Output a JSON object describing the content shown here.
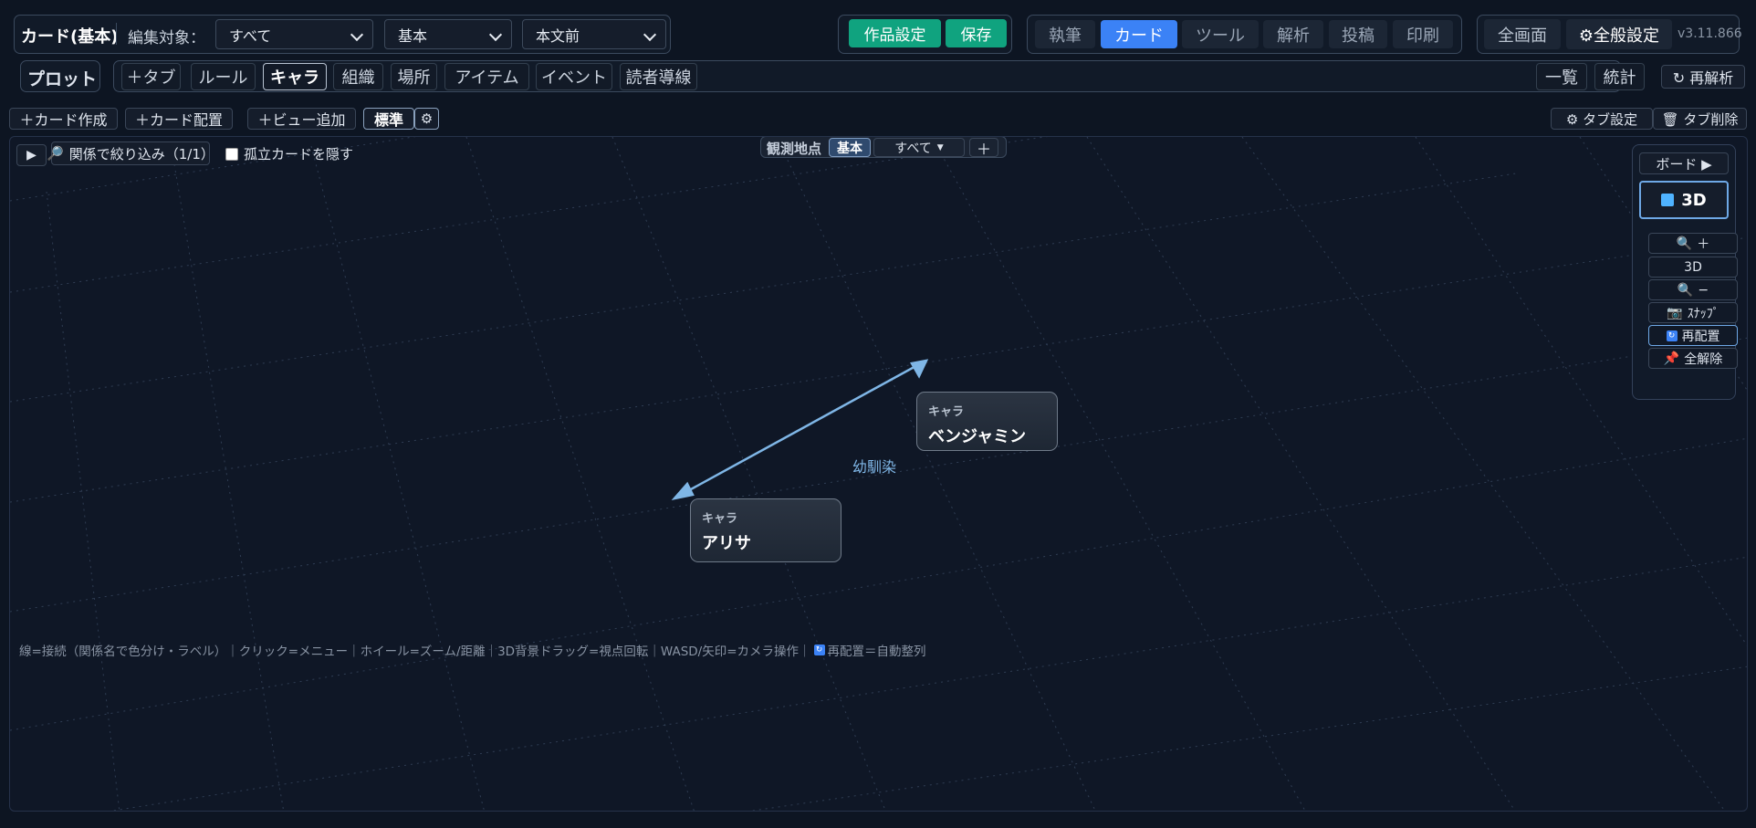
{
  "header": {
    "title": "カード(基本)",
    "edit_target_label": "編集対象：",
    "select_scope": "すべて",
    "select_view": "基本",
    "select_position": "本文前",
    "work_settings": "作品設定",
    "save": "保存",
    "mode_tabs": [
      "執筆",
      "カード",
      "ツール",
      "解析",
      "投稿",
      "印刷"
    ],
    "active_mode": "カード",
    "fullscreen": "全画面",
    "general_settings": "⚙全般設定",
    "version": "v3.11.866"
  },
  "tabs": {
    "plot": "プロット",
    "add_tab": "＋タブ",
    "items": [
      "ルール",
      "キャラ",
      "組織",
      "場所",
      "アイテム",
      "イベント",
      "読者導線"
    ],
    "active": "キャラ",
    "list": "一覧",
    "stats": "統計",
    "reanalyze": "↻ 再解析"
  },
  "toolbar": {
    "create_card": "＋カード作成",
    "place_card": "＋カード配置",
    "add_view": "＋ビュー追加",
    "standard": "標準",
    "tab_settings": "⚙ タブ設定",
    "tab_delete": "🗑 タブ削除"
  },
  "canvas_controls": {
    "filter": "関係で絞り込み（1/1）",
    "hide_isolated": "孤立カードを隠す",
    "observation_label": "観測地点",
    "observation_base": "基本",
    "observation_all": "すべて",
    "observation_add": "＋"
  },
  "right_panel": {
    "board": "ボード ▶",
    "three_d_toggle": "3D",
    "zoom_in": "＋",
    "three_d_label": "3D",
    "zoom_out": "−",
    "snap": "ｽﾅｯﾌﾟ",
    "rearrange": "再配置",
    "clear_all": "全解除"
  },
  "graph": {
    "cards": [
      {
        "kind": "キャラ",
        "name": "ベンジャミン"
      },
      {
        "kind": "キャラ",
        "name": "アリサ"
      }
    ],
    "edge_label": "幼馴染"
  },
  "footer_hint_a": "線=接続（関係名で色分け・ラベル）｜クリック=メニュー｜ホイール=ズーム/距離｜3D背景ドラッグ=視点回転｜WASD/矢印=カメラ操作｜",
  "footer_hint_b": "再配置＝自動整列",
  "colors": {
    "background": "#0d1522",
    "accent_blue": "#3b82f6",
    "green": "#10a37f",
    "edge": "#7fb6e6"
  }
}
